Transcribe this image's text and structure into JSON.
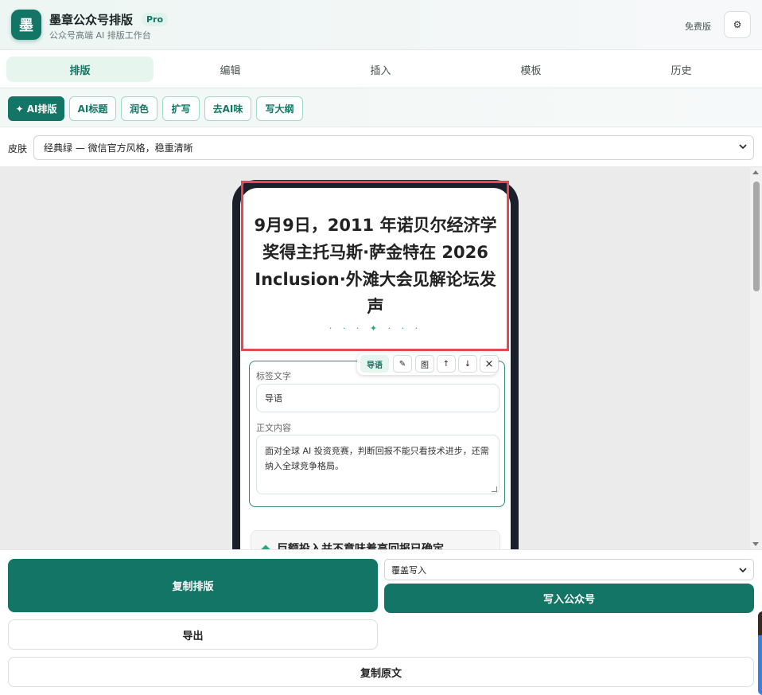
{
  "header": {
    "logo_char": "墨",
    "title": "墨章公众号排版",
    "badge": "Pro",
    "subtitle": "公众号高端 AI 排版工作台",
    "plan": "免费版",
    "settings_icon": "gear-icon"
  },
  "tabs": [
    {
      "label": "排版",
      "active": true
    },
    {
      "label": "编辑",
      "active": false
    },
    {
      "label": "插入",
      "active": false
    },
    {
      "label": "模板",
      "active": false
    },
    {
      "label": "历史",
      "active": false
    }
  ],
  "ai_toolbar": {
    "ai_layout": "✦ AI排版",
    "ai_title": "AI标题",
    "polish": "润色",
    "expand": "扩写",
    "de_ai": "去AI味",
    "outline": "写大纲"
  },
  "skin": {
    "label": "皮肤",
    "selected": "经典绿 — 微信官方风格，稳重清晰"
  },
  "article": {
    "title": "9月9日，2011 年诺贝尔经济学奖得主托马斯·萨金特在 2026 Inclusion·外滩大会见解论坛发声",
    "ornament": "· · · ✦ · · ·",
    "block_toolbar": {
      "tag": "导语",
      "edit_icon": "✎",
      "image": "图",
      "up": "↑",
      "down": "↓",
      "close": "×"
    },
    "editor": {
      "label_field_title": "标签文字",
      "label_field_value": "导语",
      "body_field_title": "正文内容",
      "body_field_value": "面对全球 AI 投资竞赛，判断回报不能只看技术进步，还需纳入全球竞争格局。"
    },
    "next_heading": "巨额投入并不意味着高回报已确定"
  },
  "actions": {
    "copy_layout": "复制排版",
    "write_mode": "覆盖写入",
    "write_wechat": "写入公众号",
    "export": "导出",
    "copy_raw": "复制原文"
  },
  "colors": {
    "brand": "#137565",
    "highlight_outline": "#e5484d"
  }
}
